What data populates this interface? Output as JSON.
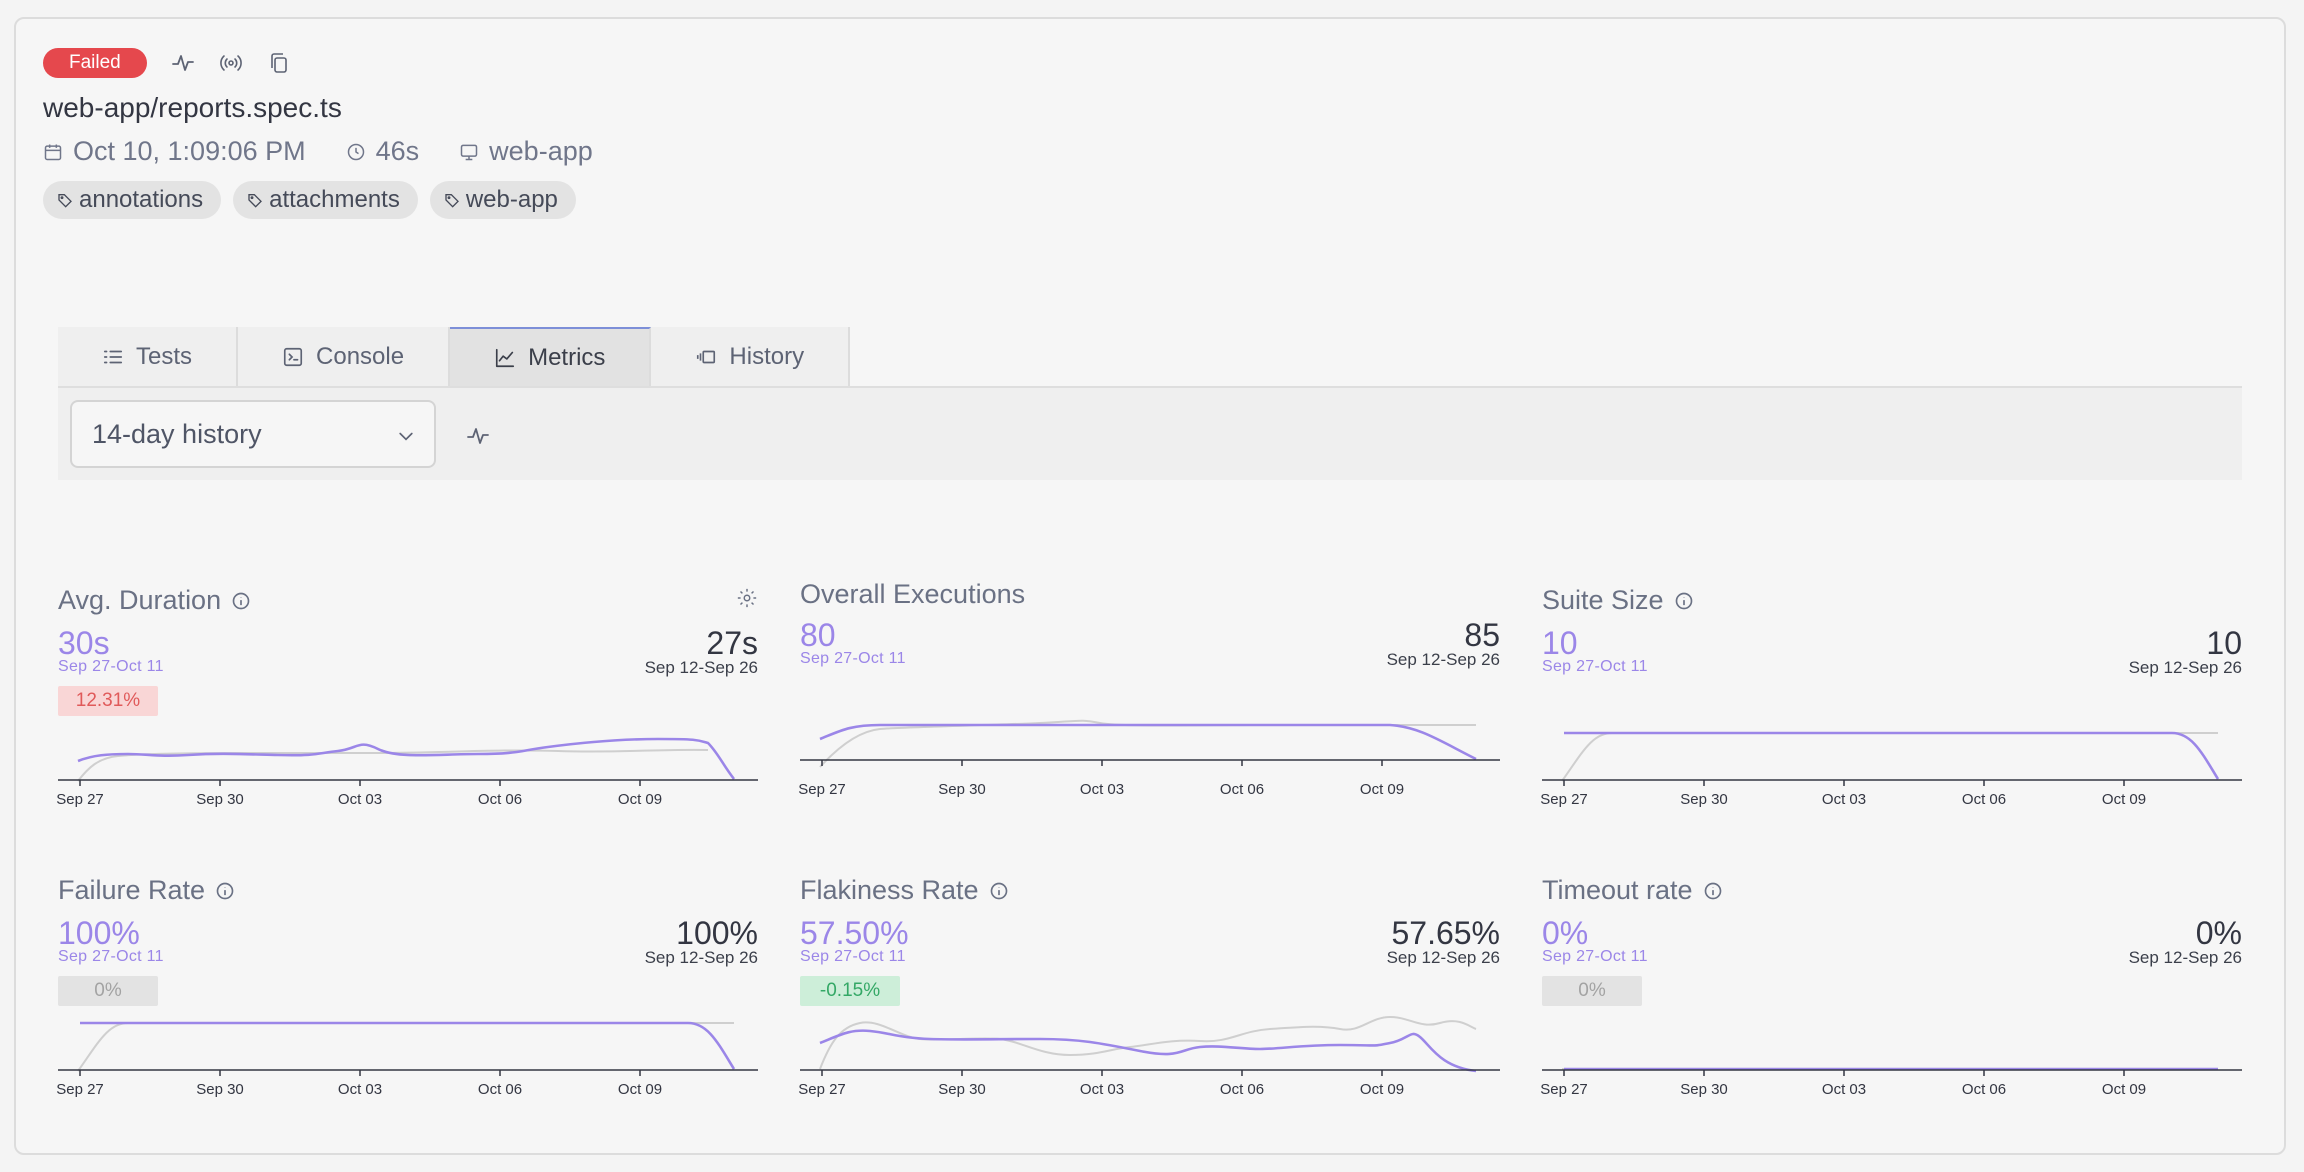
{
  "header": {
    "status": "Failed",
    "title": "web-app/reports.spec.ts",
    "date": "Oct 10, 1:09:06 PM",
    "duration": "46s",
    "project": "web-app",
    "tags": [
      "annotations",
      "attachments",
      "web-app"
    ],
    "icons": [
      "activity-icon",
      "broadcast-icon",
      "copy-icon"
    ]
  },
  "tabs": [
    {
      "label": "Tests",
      "icon": "list-icon"
    },
    {
      "label": "Console",
      "icon": "terminal-icon"
    },
    {
      "label": "Metrics",
      "icon": "chart-line-icon",
      "active": true
    },
    {
      "label": "History",
      "icon": "history-icon"
    }
  ],
  "toolbar": {
    "range_select": "14-day history"
  },
  "colors": {
    "current": "#9b86e8",
    "previous": "#cfcfcf",
    "failed_badge": "#e5484d"
  },
  "axis_labels": [
    "Sep 27",
    "Sep 30",
    "Oct 03",
    "Oct 06",
    "Oct 09"
  ],
  "metrics": [
    {
      "title": "Avg. Duration",
      "info": true,
      "settings": true,
      "current": "30s",
      "current_range": "Sep 27-Oct 11",
      "previous": "27s",
      "previous_range": "Sep 12-Sep 26",
      "delta": "12.31%",
      "delta_type": "bad"
    },
    {
      "title": "Overall Executions",
      "info": false,
      "current": "80",
      "current_range": "Sep 27-Oct 11",
      "previous": "85",
      "previous_range": "Sep 12-Sep 26",
      "delta": null
    },
    {
      "title": "Suite Size",
      "info": true,
      "current": "10",
      "current_range": "Sep 27-Oct 11",
      "previous": "10",
      "previous_range": "Sep 12-Sep 26",
      "delta": null
    },
    {
      "title": "Failure Rate",
      "info": true,
      "current": "100%",
      "current_range": "Sep 27-Oct 11",
      "previous": "100%",
      "previous_range": "Sep 12-Sep 26",
      "delta": "0%",
      "delta_type": "neutral"
    },
    {
      "title": "Flakiness Rate",
      "info": true,
      "current": "57.50%",
      "current_range": "Sep 27-Oct 11",
      "previous": "57.65%",
      "previous_range": "Sep 12-Sep 26",
      "delta": "-0.15%",
      "delta_type": "good"
    },
    {
      "title": "Timeout rate",
      "info": true,
      "current": "0%",
      "current_range": "Sep 27-Oct 11",
      "previous": "0%",
      "previous_range": "Sep 12-Sep 26",
      "delta": "0%",
      "delta_type": "neutral"
    }
  ]
}
